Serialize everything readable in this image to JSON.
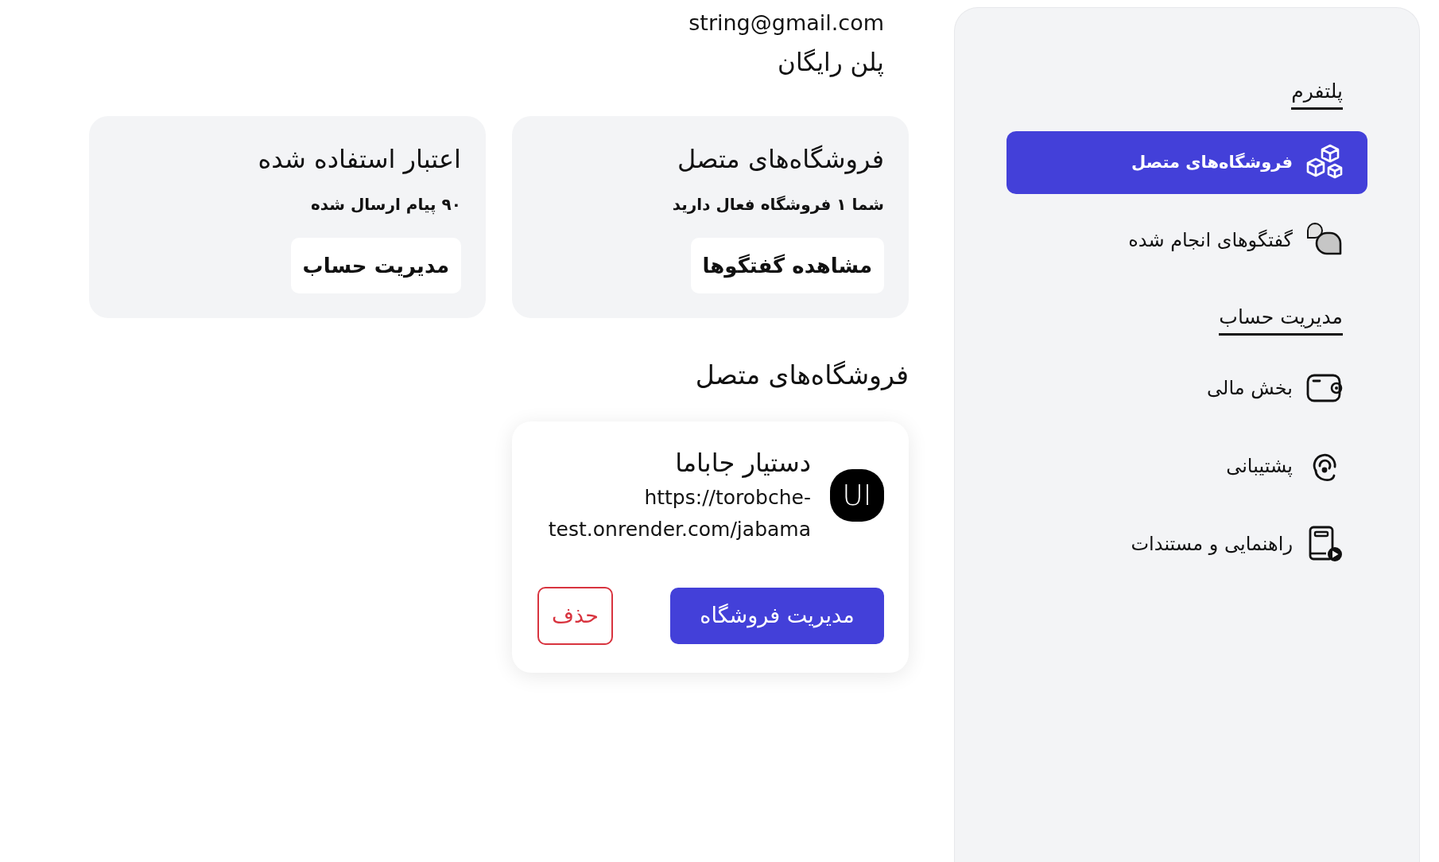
{
  "sidebar": {
    "groups": [
      {
        "heading": "پلتفرم",
        "items": [
          {
            "label": "فروشگاه‌های متصل",
            "selected": true
          },
          {
            "label": "گفتگوهای انجام شده",
            "selected": false
          }
        ]
      },
      {
        "heading": "مدیریت حساب",
        "items": [
          {
            "label": "بخش مالی",
            "selected": false
          },
          {
            "label": "پشتیبانی",
            "selected": false
          },
          {
            "label": "راهنمایی و مستندات",
            "selected": false
          }
        ]
      }
    ]
  },
  "account": {
    "email": "string@gmail.com",
    "plan": "پلن رایگان"
  },
  "summary_cards": [
    {
      "title": "فروشگاه‌های متصل",
      "subtitle": "شما ۱ فروشگاه فعال دارید",
      "button": "مشاهده گفتگوها"
    },
    {
      "title": "اعتبار استفاده شده",
      "subtitle": "۹۰ پیام ارسال شده",
      "button": "مدیریت حساب"
    }
  ],
  "stores_section": {
    "title": "فروشگاه‌های متصل",
    "stores": [
      {
        "avatar": "UI",
        "name": "دستیار جاباما",
        "url": "https://torobche-test.onrender.com/jabama",
        "actions": [
          {
            "label": "مدیریت فروشگاه",
            "kind": "primary"
          },
          {
            "label": "حذف",
            "kind": "danger"
          }
        ]
      }
    ]
  }
}
